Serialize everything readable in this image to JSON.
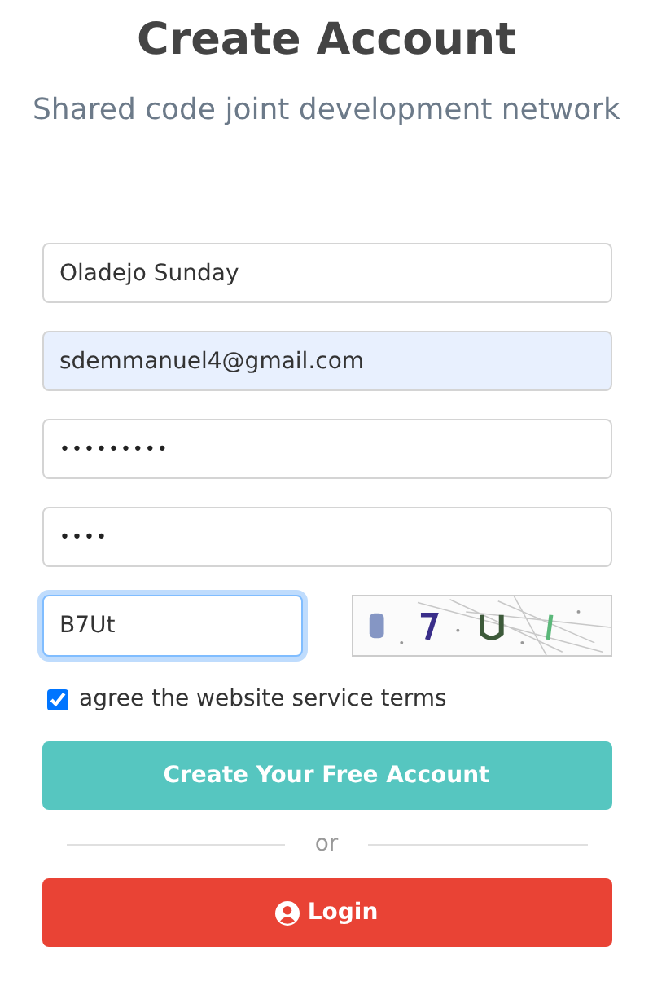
{
  "title": "Create Account",
  "subtitle": "Shared code joint development network",
  "fields": [
    {
      "kind": "text",
      "value": "Oladejo Sunday",
      "autofilled": false,
      "focused": false
    },
    {
      "kind": "text",
      "value": "sdemmanuel4@gmail.com",
      "autofilled": true,
      "focused": false
    },
    {
      "kind": "password",
      "value": "•••••••••",
      "autofilled": false,
      "focused": false
    },
    {
      "kind": "password",
      "value": "••••",
      "autofilled": false,
      "focused": false
    }
  ],
  "captcha": {
    "value": "B7Ut",
    "focused": true
  },
  "terms": {
    "label": "agree the website service terms",
    "checked": true
  },
  "create_button": "Create Your Free Account",
  "divider": "or",
  "login_button": "Login"
}
